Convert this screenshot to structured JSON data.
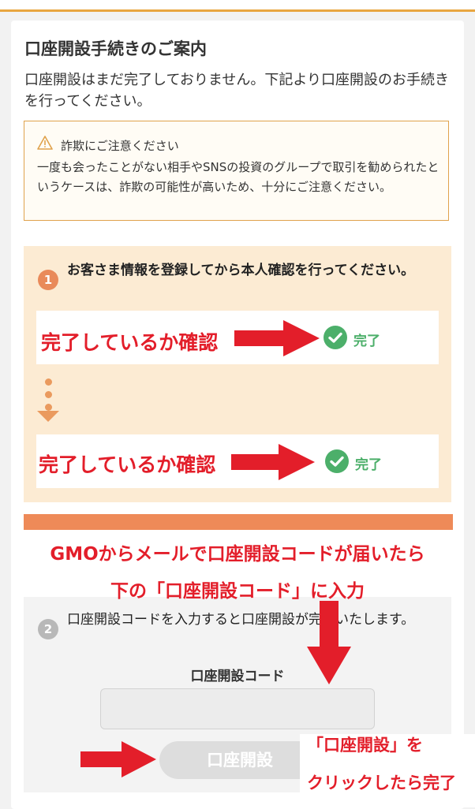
{
  "page": {
    "title": "口座開設手続きのご案内",
    "description": "口座開設はまだ完了しておりません。下記より口座開設のお手続きを行ってください。"
  },
  "warning": {
    "title": "詐欺にご注意ください",
    "body": "一度も会ったことがない相手やSNSの投資のグループで取引を勧められたというケースは、詐欺の可能性が高いため、十分にご注意ください。"
  },
  "step1": {
    "number": "1",
    "text": "お客さま情報を登録してから本人確認を行ってください。",
    "items": [
      {
        "status": "完了"
      },
      {
        "status": "完了"
      }
    ]
  },
  "step2": {
    "number": "2",
    "text": "口座開設コードを入力すると口座開設が完了いたします。",
    "code_label": "口座開設コード",
    "code_value": "",
    "button_label": "口座開設"
  },
  "annotations": {
    "confirm1": "完了しているか確認",
    "confirm2": "完了しているか確認",
    "line1": "GMOからメールで口座開設コードが届いたら",
    "line2": "下の「口座開設コード」に入力",
    "click1": "「口座開設」を",
    "click2": "クリックしたら完了"
  },
  "colors": {
    "accent": "#ee8a58",
    "done": "#4caf6a",
    "annotation": "#e31e2a",
    "warning_border": "#e0a24c"
  },
  "icons": [
    "warning-icon",
    "check-circle-icon",
    "red-arrow"
  ]
}
